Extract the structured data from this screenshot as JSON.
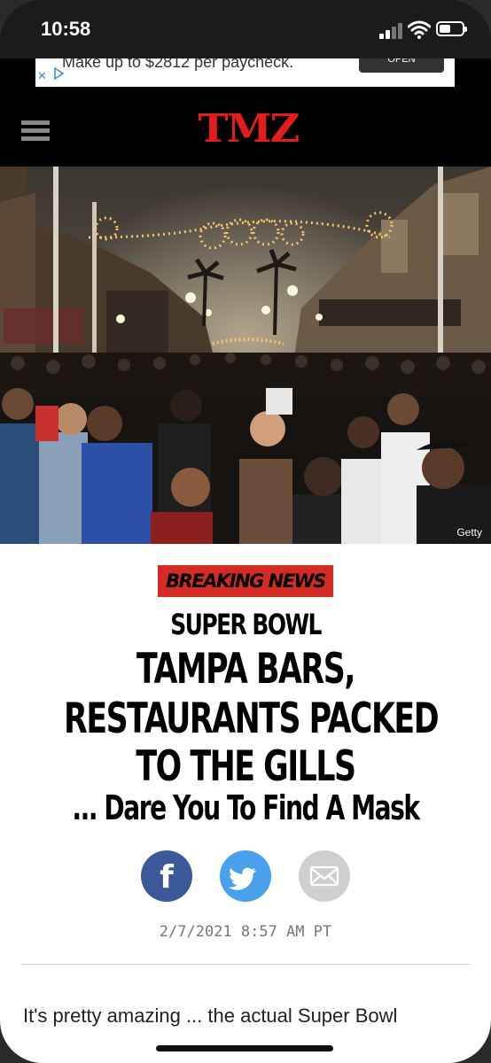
{
  "status_bar": {
    "time": "10:58"
  },
  "ad": {
    "text": "Make up to $2812 per paycheck.",
    "button_label": "OPEN",
    "close_glyph": "✕"
  },
  "header": {
    "logo_text": "TMZ",
    "menu_icon": "hamburger-icon"
  },
  "hero": {
    "photo_credit": "Getty"
  },
  "article": {
    "badge": "BREAKING NEWS",
    "kicker": "SUPER BOWL",
    "headline_lines": [
      "TAMPA BARS,",
      "RESTAURANTS PACKED",
      "TO THE GILLS"
    ],
    "subhead": "... Dare You To Find A Mask",
    "share": {
      "facebook_glyph": "f"
    },
    "timestamp": "2/7/2021 8:57 AM PT",
    "body_preview": "It's pretty amazing ... the actual Super Bowl"
  },
  "colors": {
    "brand_red": "#e21d1d",
    "badge_red": "#d42b24",
    "facebook": "#3b5998",
    "twitter": "#49a1eb",
    "email": "#cfcfcf"
  }
}
